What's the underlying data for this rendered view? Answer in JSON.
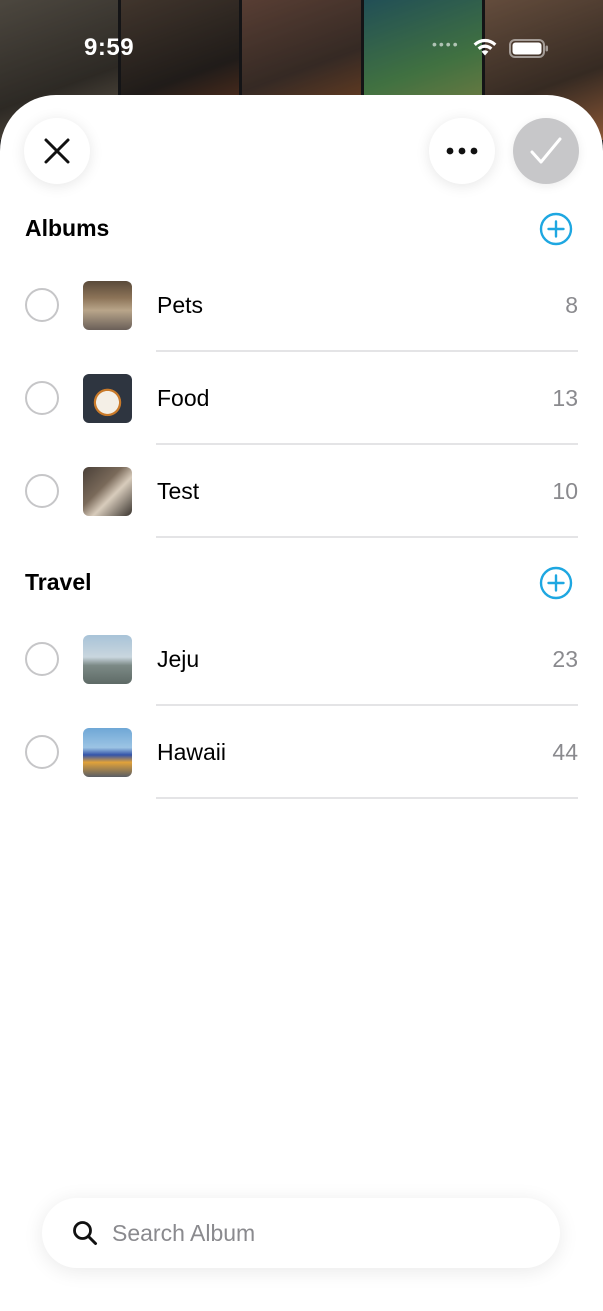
{
  "status_bar": {
    "time": "9:59"
  },
  "header": {
    "close_icon": "close-icon",
    "more_icon": "ellipsis-icon",
    "done_icon": "checkmark-icon"
  },
  "sections": [
    {
      "title": "Albums",
      "add_icon": "plus-circle-icon",
      "items": [
        {
          "label": "Pets",
          "count": "8"
        },
        {
          "label": "Food",
          "count": "13"
        },
        {
          "label": "Test",
          "count": "10"
        }
      ]
    },
    {
      "title": "Travel",
      "add_icon": "plus-circle-icon",
      "items": [
        {
          "label": "Jeju",
          "count": "23"
        },
        {
          "label": "Hawaii",
          "count": "44"
        }
      ]
    }
  ],
  "search": {
    "placeholder": "Search Album",
    "value": ""
  },
  "colors": {
    "accent": "#1ea7e1",
    "done_disabled": "#c7c7c9",
    "count_text": "#8a8a8e"
  }
}
